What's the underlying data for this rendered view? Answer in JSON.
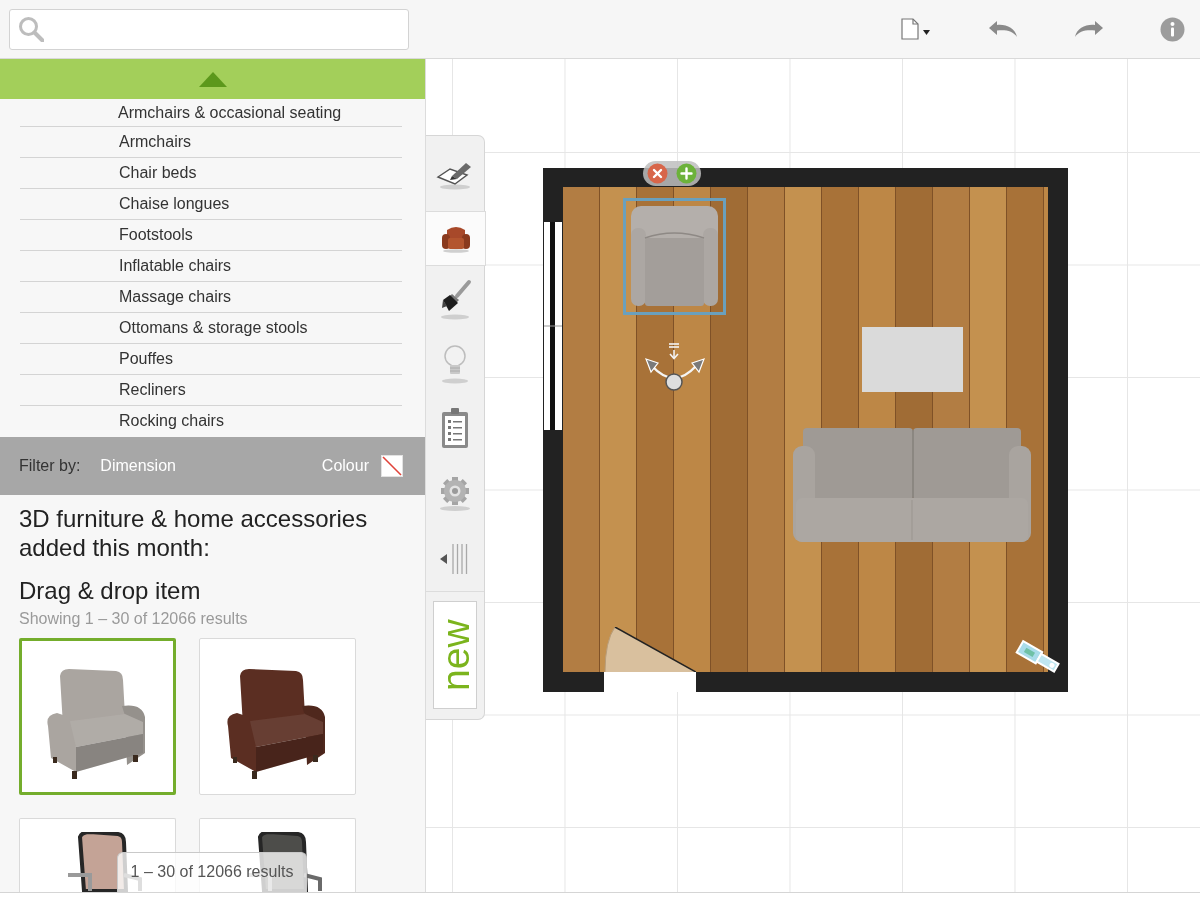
{
  "category_list": {
    "heading": "Armchairs & occasional seating",
    "items": [
      "Armchairs",
      "Chair beds",
      "Chaise longues",
      "Footstools",
      "Inflatable chairs",
      "Massage chairs",
      "Ottomans & storage stools",
      "Pouffes",
      "Recliners",
      "Rocking chairs"
    ]
  },
  "filter_bar": {
    "label": "Filter by:",
    "filters": [
      {
        "label": "Dimension",
        "kind": "text"
      },
      {
        "label": "Colour",
        "kind": "swatch"
      }
    ]
  },
  "catalog": {
    "title": "3D furniture & home accessories added this month:",
    "subtitle": "Drag & drop item",
    "count": "Showing 1 – 30 of 12066 results",
    "products": [
      {
        "kind": "armchair",
        "color": "#aaa5a0",
        "selected": true
      },
      {
        "kind": "armchair",
        "color": "#5b2e22",
        "selected": false
      },
      {
        "kind": "desk-chair",
        "color": "#c4a396",
        "selected": false
      },
      {
        "kind": "desk-chair",
        "color": "#4d4d4a",
        "selected": false
      }
    ],
    "pager": "1 – 30 of 12066 results"
  },
  "side_tabs": [
    {
      "kind": "tools",
      "selected": false
    },
    {
      "kind": "furniture",
      "selected": true
    },
    {
      "kind": "paint",
      "selected": false
    },
    {
      "kind": "lighting",
      "selected": false
    },
    {
      "kind": "notes",
      "selected": false
    },
    {
      "kind": "settings",
      "selected": false
    }
  ],
  "new_tab": {
    "label": "new"
  },
  "floor_plan": {
    "items": [
      {
        "kind": "armchair",
        "selected": true
      },
      {
        "kind": "block",
        "selected": false
      },
      {
        "kind": "sofa",
        "selected": false
      }
    ]
  }
}
